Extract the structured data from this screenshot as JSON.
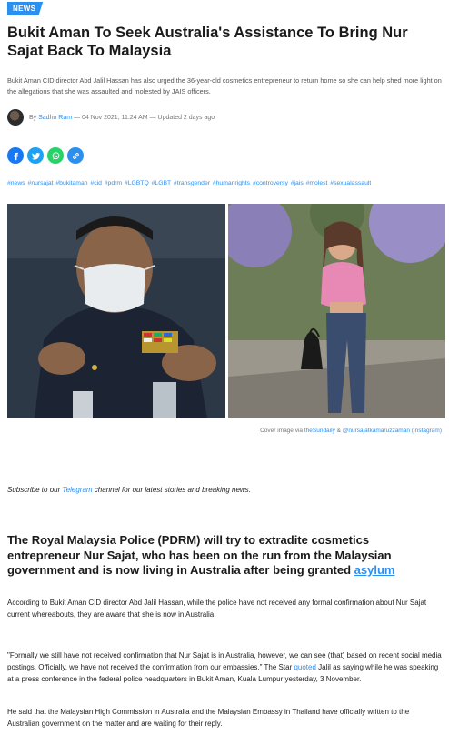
{
  "badge": "NEWS",
  "title": "Bukit Aman To Seek Australia's Assistance To Bring Nur Sajat Back To Malaysia",
  "lede": "Bukit Aman CID director Abd Jalil Hassan has also urged the 36-year-old cosmetics entrepreneur to return home so she can help shed more light on the allegations that she was assaulted and molested by JAIS officers.",
  "byline": {
    "by": "By",
    "author": "Sadho Ram",
    "meta": "— 04 Nov 2021, 11:24 AM — Updated 2 days ago"
  },
  "share": [
    {
      "name": "facebook-icon",
      "color": "#1877f2"
    },
    {
      "name": "twitter-icon",
      "color": "#1da1f2"
    },
    {
      "name": "whatsapp-icon",
      "color": "#25d366"
    },
    {
      "name": "link-icon",
      "color": "#2b8ff0"
    }
  ],
  "tags": "#news #nursajat #bukitaman #cid #pdrm #LGBTQ #LGBT #transgender #humanrights #controversy #jais #molest #sexualassault",
  "caption": {
    "prefix": "Cover image via",
    "source1": "theSundaily",
    "amp": "&",
    "source2": "@nursajatkamaruzzaman (Instagram)"
  },
  "subscribe": {
    "before": "Subscribe to our",
    "link": "Telegram",
    "after": "channel for our latest stories and breaking news."
  },
  "heading": {
    "text": "The Royal Malaysia Police (PDRM) will try to extradite cosmetics entrepreneur Nur Sajat, who has been on the run from the Malaysian government and is now living in Australia after being granted",
    "link": "asylum"
  },
  "paragraphs": {
    "p1": "According to Bukit Aman CID director Abd Jalil Hassan, while the police have not received any formal confirmation about Nur Sajat current whereabouts, they are aware that she is now in Australia.",
    "p2_a": "\"Formally we still have not received confirmation that Nur Sajat is in Australia, however, we can see (that) based on recent social media postings. Officially, we have not received the confirmation from our embassies,\" The Star",
    "p2_link": "quoted",
    "p2_b": "Jalil as saying while he was speaking at a press conference in the federal police headquarters in Bukit Aman, Kuala Lumpur yesterday, 3 November.",
    "p3": "He said that the Malaysian High Commission in Australia and the Malaysian Embassy in Thailand have officially written to the Australian government on the matter and are waiting for their reply."
  }
}
